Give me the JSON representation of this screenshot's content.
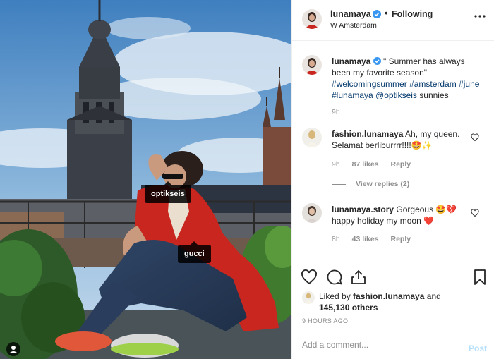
{
  "photo": {
    "tags": [
      "optikseis",
      "gucci"
    ],
    "user_tags_icon": "person-icon"
  },
  "header": {
    "username": "lunamaya",
    "verified_icon": "verified-badge-icon",
    "separator": "•",
    "follow_state": "Following",
    "location": "W Amsterdam",
    "more_icon": "more-options-icon"
  },
  "caption": {
    "username": "lunamaya",
    "text": "\" Summer has always been my favorite season\"",
    "hashtags_line1": "#welcomingsummer #amsterdam",
    "hashtags_line2": "#june #lunamaya @optikseis",
    "trailing_text": "sunnies",
    "time": "9h"
  },
  "comments": [
    {
      "username": "fashion.lunamaya",
      "text": "Ah, my queen. Selamat berliburrrr!!!!🤩✨",
      "time": "9h",
      "likes": "87 likes",
      "reply_label": "Reply",
      "view_replies": "View replies (2)"
    },
    {
      "username": "lunamaya.story",
      "text": "Gorgeous 🤩💔 happy holiday my moon ❤️",
      "time": "8h",
      "likes": "43 likes",
      "reply_label": "Reply"
    }
  ],
  "actions": {
    "like_icon": "heart-icon",
    "comment_icon": "comment-icon",
    "share_icon": "share-icon",
    "save_icon": "bookmark-icon"
  },
  "likes": {
    "prefix": "Liked by",
    "user": "fashion.lunamaya",
    "conjunction": "and",
    "count": "145,130 others"
  },
  "timestamp": "9 HOURS AGO",
  "comment_box": {
    "placeholder": "Add a comment...",
    "post_label": "Post"
  },
  "colors": {
    "link": "#00376b",
    "verified": "#3897f0",
    "post_disabled": "#b2dffc",
    "meta": "#8e8e8e"
  }
}
